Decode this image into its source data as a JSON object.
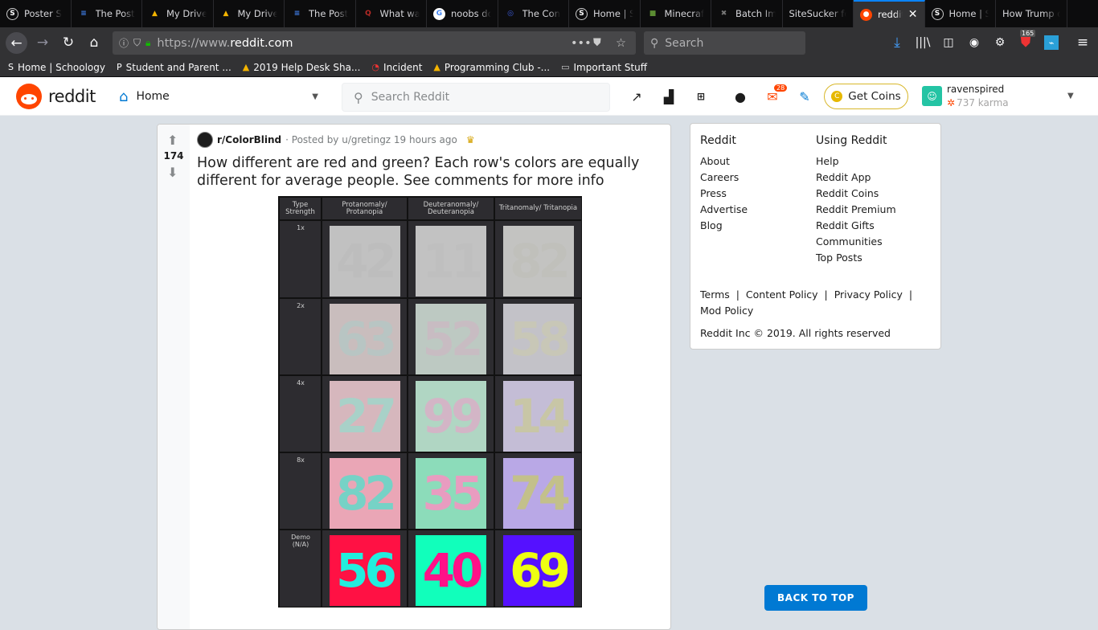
{
  "tabs": [
    {
      "label": "Poster S",
      "icon": "schoology-icon",
      "color": "#2f6fbf",
      "glyph": "S"
    },
    {
      "label": "The Post",
      "icon": "docs-icon",
      "color": "#4285f4",
      "glyph": "≡"
    },
    {
      "label": "My Drive",
      "icon": "drive-icon",
      "color": "#f4b400",
      "glyph": "▲"
    },
    {
      "label": "My Drive",
      "icon": "drive-icon",
      "color": "#f4b400",
      "glyph": "▲"
    },
    {
      "label": "The Post",
      "icon": "docs-icon",
      "color": "#4285f4",
      "glyph": "≡"
    },
    {
      "label": "What wa",
      "icon": "quora-icon",
      "color": "#b92b27",
      "glyph": "Q"
    },
    {
      "label": "noobs do",
      "icon": "google-icon",
      "color": "#ffffff",
      "glyph": "G"
    },
    {
      "label": "The Con",
      "icon": "site-icon",
      "color": "#3b5bdb",
      "glyph": "◎"
    },
    {
      "label": "Home | S",
      "icon": "schoology-icon",
      "color": "#2f6fbf",
      "glyph": "S"
    },
    {
      "label": "Minecraf",
      "icon": "minecraft-icon",
      "color": "#5b8c32",
      "glyph": "■"
    },
    {
      "label": "Batch Im",
      "icon": "batch-icon",
      "color": "#777777",
      "glyph": "✖"
    },
    {
      "label": "SiteSucker fo",
      "icon": "",
      "color": "",
      "glyph": ""
    },
    {
      "label": "reddit",
      "icon": "reddit-icon",
      "color": "#ff4500",
      "glyph": "●",
      "active": true
    },
    {
      "label": "Home | S",
      "icon": "schoology-icon",
      "color": "#2f6fbf",
      "glyph": "S"
    },
    {
      "label": "How Trump d",
      "icon": "",
      "color": "",
      "glyph": ""
    }
  ],
  "nav": {
    "url_prefix": "https://www.",
    "url_domain": "reddit.com",
    "search_placeholder": "Search",
    "badge": "165"
  },
  "bookmarks": [
    {
      "label": "Home | Schoology",
      "icon": "schoology-icon"
    },
    {
      "label": "Student and Parent ...",
      "icon": "p-icon"
    },
    {
      "label": "2019 Help Desk Sha...",
      "icon": "drive-icon"
    },
    {
      "label": "Incident",
      "icon": "incident-icon"
    },
    {
      "label": "Programming Club -...",
      "icon": "drive-icon"
    },
    {
      "label": "Important Stuff",
      "icon": "folder-icon"
    }
  ],
  "reddit": {
    "logo": "reddit",
    "feed": "Home",
    "search_placeholder": "Search Reddit",
    "mail_badge": "28",
    "coins_label": "Get Coins",
    "username": "ravenspired",
    "karma": "737 karma"
  },
  "post": {
    "votes": "174",
    "subreddit": "r/ColorBlind",
    "meta": "· Posted by u/gretingz 19 hours ago",
    "title": "How different are red and green? Each row's colors are equally different for average people. See comments for more info",
    "image": {
      "headers": [
        "Type\nStrength",
        "Protanomaly/\nProtanopia",
        "Deuteranomaly/\nDeuteranopia",
        "Tritanomaly/ Tritanopia"
      ],
      "rows": [
        {
          "label": "1x",
          "cells": [
            {
              "num": "42",
              "bg": "#c1c1c1",
              "fg": "#bdbdbd"
            },
            {
              "num": "11",
              "bg": "#c2c2c2",
              "fg": "#bfbfbf"
            },
            {
              "num": "82",
              "bg": "#c3c3c1",
              "fg": "#c0c0bb"
            }
          ]
        },
        {
          "label": "2x",
          "cells": [
            {
              "num": "63",
              "bg": "#c9bdbd",
              "fg": "#b8c5c3"
            },
            {
              "num": "52",
              "bg": "#bdc9c2",
              "fg": "#c8bcc2"
            },
            {
              "num": "58",
              "bg": "#c3c2c8",
              "fg": "#c8c7b7"
            }
          ]
        },
        {
          "label": "4x",
          "cells": [
            {
              "num": "27",
              "bg": "#d6b7bd",
              "fg": "#a8d1c8"
            },
            {
              "num": "99",
              "bg": "#b0d6c3",
              "fg": "#d3b5c6"
            },
            {
              "num": "14",
              "bg": "#c4bdd6",
              "fg": "#c8c6a6"
            }
          ]
        },
        {
          "label": "8x",
          "cells": [
            {
              "num": "82",
              "bg": "#eaa6b6",
              "fg": "#76d2c6"
            },
            {
              "num": "35",
              "bg": "#8cdcba",
              "fg": "#e89cc0"
            },
            {
              "num": "74",
              "bg": "#b9a8e6",
              "fg": "#c3c08b"
            }
          ]
        },
        {
          "label": "Demo\n(N/A)",
          "cells": [
            {
              "num": "56",
              "bg": "#ff1144",
              "fg": "#22eedd"
            },
            {
              "num": "40",
              "bg": "#11ffbb",
              "fg": "#ff1188"
            },
            {
              "num": "69",
              "bg": "#5511ff",
              "fg": "#eeff11"
            }
          ]
        }
      ]
    }
  },
  "sidebar": {
    "col1_title": "Reddit",
    "col1": [
      "About",
      "Careers",
      "Press",
      "Advertise",
      "Blog"
    ],
    "col2_title": "Using Reddit",
    "col2": [
      "Help",
      "Reddit App",
      "Reddit Coins",
      "Reddit Premium",
      "Reddit Gifts",
      "Communities",
      "Top Posts"
    ],
    "policy": [
      "Terms",
      "Content Policy",
      "Privacy Policy",
      "Mod Policy"
    ],
    "copyright": "Reddit Inc © 2019. All rights reserved"
  },
  "back_to_top": "BACK TO TOP",
  "colors": {
    "reddit_orange": "#ff4500",
    "reddit_blue": "#0079d3",
    "firefox_blue": "#0a84ff"
  }
}
